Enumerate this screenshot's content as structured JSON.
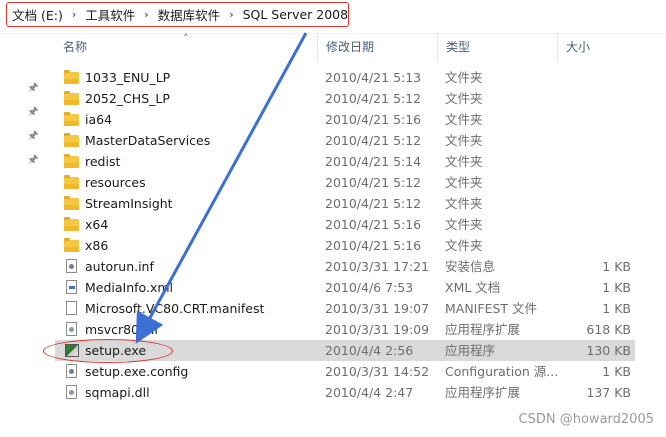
{
  "breadcrumb": {
    "items": [
      "文档 (E:)",
      "工具软件",
      "数据库软件",
      "SQL Server 2008"
    ],
    "separator": "›"
  },
  "columns": {
    "name": "名称",
    "modified": "修改日期",
    "type": "类型",
    "size": "大小"
  },
  "files": [
    {
      "name": "1033_ENU_LP",
      "modified": "2010/4/21 5:13",
      "type": "文件夹",
      "size": "",
      "icon": "folder-icon"
    },
    {
      "name": "2052_CHS_LP",
      "modified": "2010/4/21 5:12",
      "type": "文件夹",
      "size": "",
      "icon": "folder-icon"
    },
    {
      "name": "ia64",
      "modified": "2010/4/21 5:16",
      "type": "文件夹",
      "size": "",
      "icon": "folder-icon"
    },
    {
      "name": "MasterDataServices",
      "modified": "2010/4/21 5:12",
      "type": "文件夹",
      "size": "",
      "icon": "folder-icon"
    },
    {
      "name": "redist",
      "modified": "2010/4/21 5:14",
      "type": "文件夹",
      "size": "",
      "icon": "folder-icon"
    },
    {
      "name": "resources",
      "modified": "2010/4/21 5:12",
      "type": "文件夹",
      "size": "",
      "icon": "folder-icon"
    },
    {
      "name": "StreamInsight",
      "modified": "2010/4/21 5:12",
      "type": "文件夹",
      "size": "",
      "icon": "folder-icon"
    },
    {
      "name": "x64",
      "modified": "2010/4/21 5:16",
      "type": "文件夹",
      "size": "",
      "icon": "folder-icon"
    },
    {
      "name": "x86",
      "modified": "2010/4/21 5:16",
      "type": "文件夹",
      "size": "",
      "icon": "folder-icon"
    },
    {
      "name": "autorun.inf",
      "modified": "2010/3/31 17:21",
      "type": "安装信息",
      "size": "1 KB",
      "icon": "inf-file-icon"
    },
    {
      "name": "MediaInfo.xml",
      "modified": "2010/4/6 7:53",
      "type": "XML 文档",
      "size": "1 KB",
      "icon": "xml-file-icon"
    },
    {
      "name": "Microsoft.VC80.CRT.manifest",
      "modified": "2010/3/31 19:07",
      "type": "MANIFEST 文件",
      "size": "1 KB",
      "icon": "manifest-file-icon"
    },
    {
      "name": "msvcr80.dll",
      "modified": "2010/3/31 19:09",
      "type": "应用程序扩展",
      "size": "618 KB",
      "icon": "dll-file-icon"
    },
    {
      "name": "setup.exe",
      "modified": "2010/4/4 2:56",
      "type": "应用程序",
      "size": "130 KB",
      "icon": "setup-exe-icon",
      "selected": true
    },
    {
      "name": "setup.exe.config",
      "modified": "2010/3/31 14:52",
      "type": "Configuration 源...",
      "size": "1 KB",
      "icon": "config-file-icon"
    },
    {
      "name": "sqmapi.dll",
      "modified": "2010/4/4 2:47",
      "type": "应用程序扩展",
      "size": "137 KB",
      "icon": "dll-file-icon"
    }
  ],
  "watermark": "CSDN @howard2005",
  "colors": {
    "annotation_red": "#e0342b",
    "arrow_blue": "#3b6fd4",
    "selection_bg": "#d9d9d9",
    "folder_yellow": "#f5c843"
  }
}
